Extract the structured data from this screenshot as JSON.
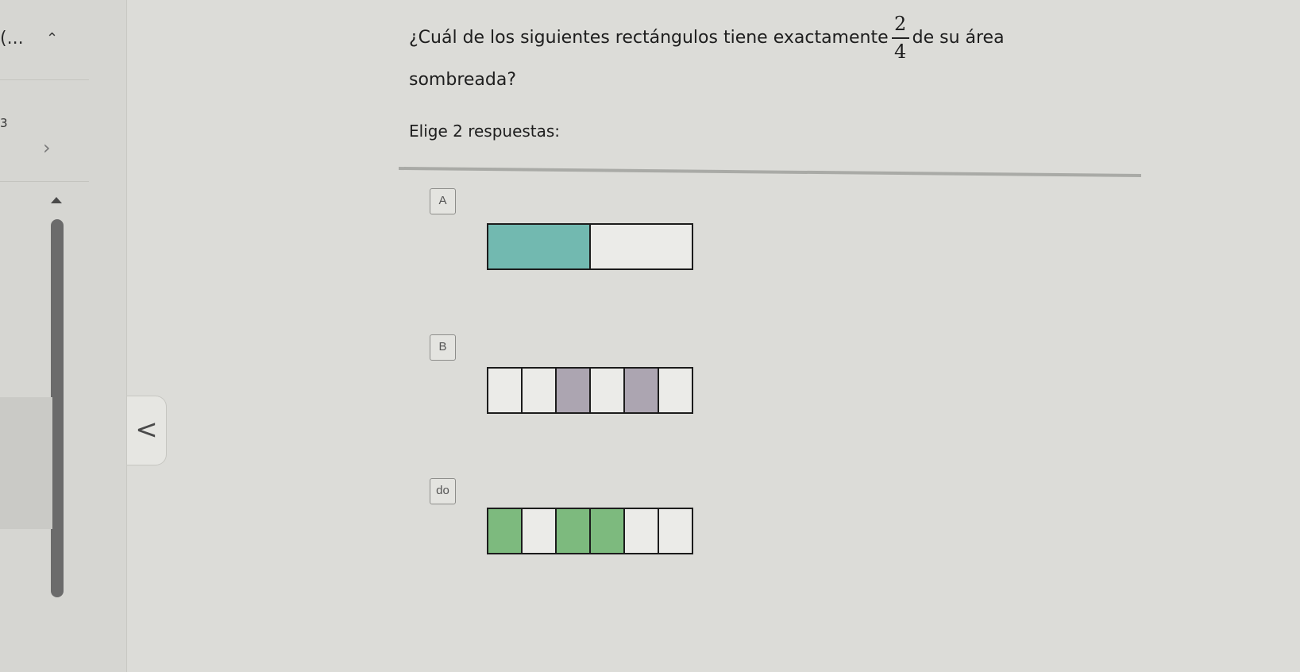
{
  "sidebar": {
    "ellipsis": "(...",
    "caret_icon": "chevron-up-icon",
    "number": "3",
    "next_icon": "chevron-right-icon",
    "scroll_icon": "triangle-up-icon"
  },
  "nav": {
    "prev_icon": "chevron-left-icon",
    "prev_glyph": "<"
  },
  "question": {
    "text_before": "¿Cuál de los siguientes rectángulos tiene exactamente",
    "fraction": {
      "numerator": "2",
      "denominator": "4"
    },
    "text_after": "de su área",
    "text_line2": "sombreada?"
  },
  "prompt": "Elige 2 respuestas:",
  "colors": {
    "teal": "#72b9b0",
    "mauve": "#aca5b1",
    "green": "#7dba7e",
    "unshaded": "#ebebe8"
  },
  "options": [
    {
      "label": "A",
      "cells": 2,
      "shaded": [
        0
      ],
      "color": "#72b9b0"
    },
    {
      "label": "B",
      "cells": 6,
      "shaded": [
        2,
        4
      ],
      "color": "#aca5b1"
    },
    {
      "label": "do",
      "cells": 6,
      "shaded": [
        0,
        2,
        3
      ],
      "color": "#7dba7e"
    }
  ]
}
